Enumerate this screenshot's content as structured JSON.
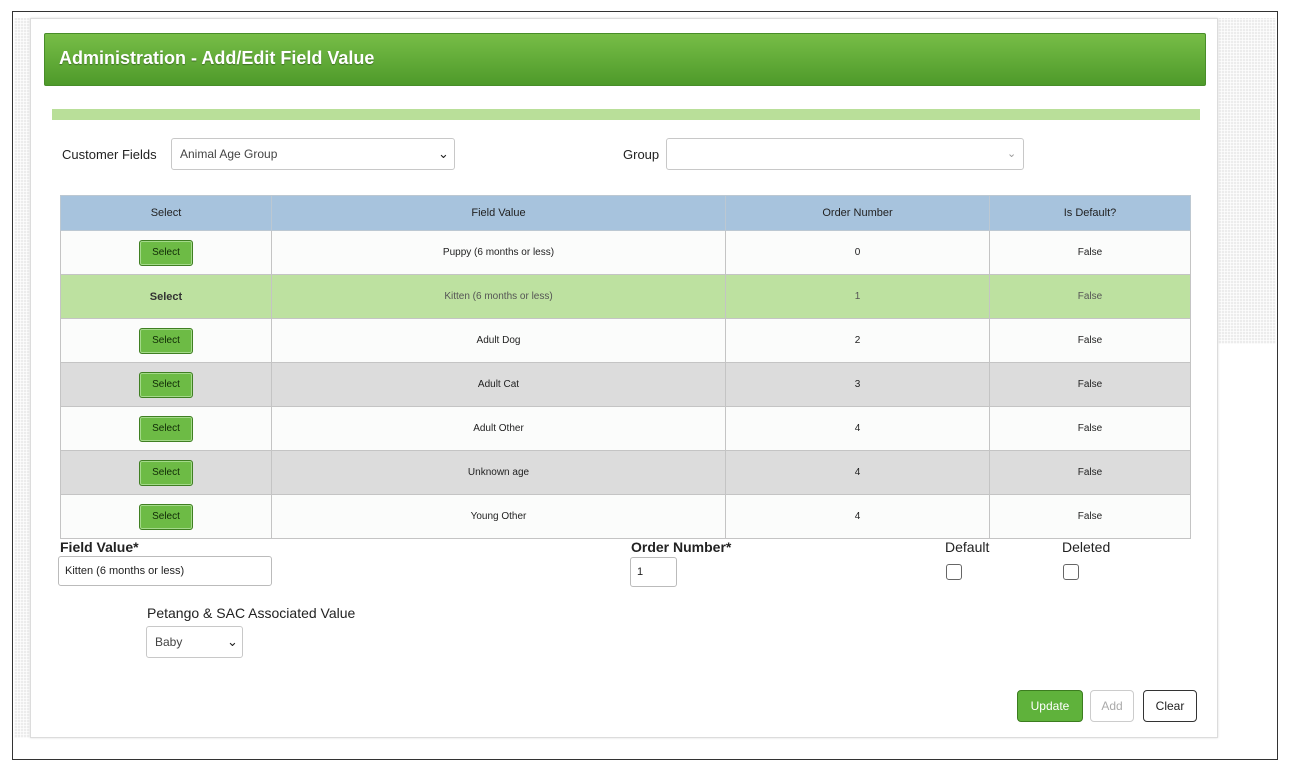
{
  "title": "Administration - Add/Edit Field Value",
  "filters": {
    "customer_fields_label": "Customer Fields",
    "customer_fields_value": "Animal Age Group",
    "group_label": "Group",
    "group_value": ""
  },
  "table": {
    "headers": [
      "Select",
      "Field Value",
      "Order Number",
      "Is Default?"
    ],
    "select_label": "Select",
    "rows": [
      {
        "field_value": "Puppy (6 months or less)",
        "order": "0",
        "is_default": "False"
      },
      {
        "field_value": "Kitten (6 months or less)",
        "order": "1",
        "is_default": "False"
      },
      {
        "field_value": "Adult Dog",
        "order": "2",
        "is_default": "False"
      },
      {
        "field_value": "Adult Cat",
        "order": "3",
        "is_default": "False"
      },
      {
        "field_value": "Adult Other",
        "order": "4",
        "is_default": "False"
      },
      {
        "field_value": "Unknown age",
        "order": "4",
        "is_default": "False"
      },
      {
        "field_value": "Young Other",
        "order": "4",
        "is_default": "False"
      }
    ]
  },
  "form": {
    "field_value_label": "Field Value*",
    "field_value": "Kitten (6 months or less)",
    "order_number_label": "Order Number*",
    "order_number": "1",
    "default_label": "Default",
    "deleted_label": "Deleted",
    "petango_label": "Petango & SAC Associated Value",
    "petango_value": "Baby"
  },
  "buttons": {
    "update": "Update",
    "add": "Add",
    "clear": "Clear"
  },
  "colors": {
    "title_green": "#5ea836",
    "header_blue": "#a7c3dd",
    "selected_row": "#bde1a0"
  }
}
